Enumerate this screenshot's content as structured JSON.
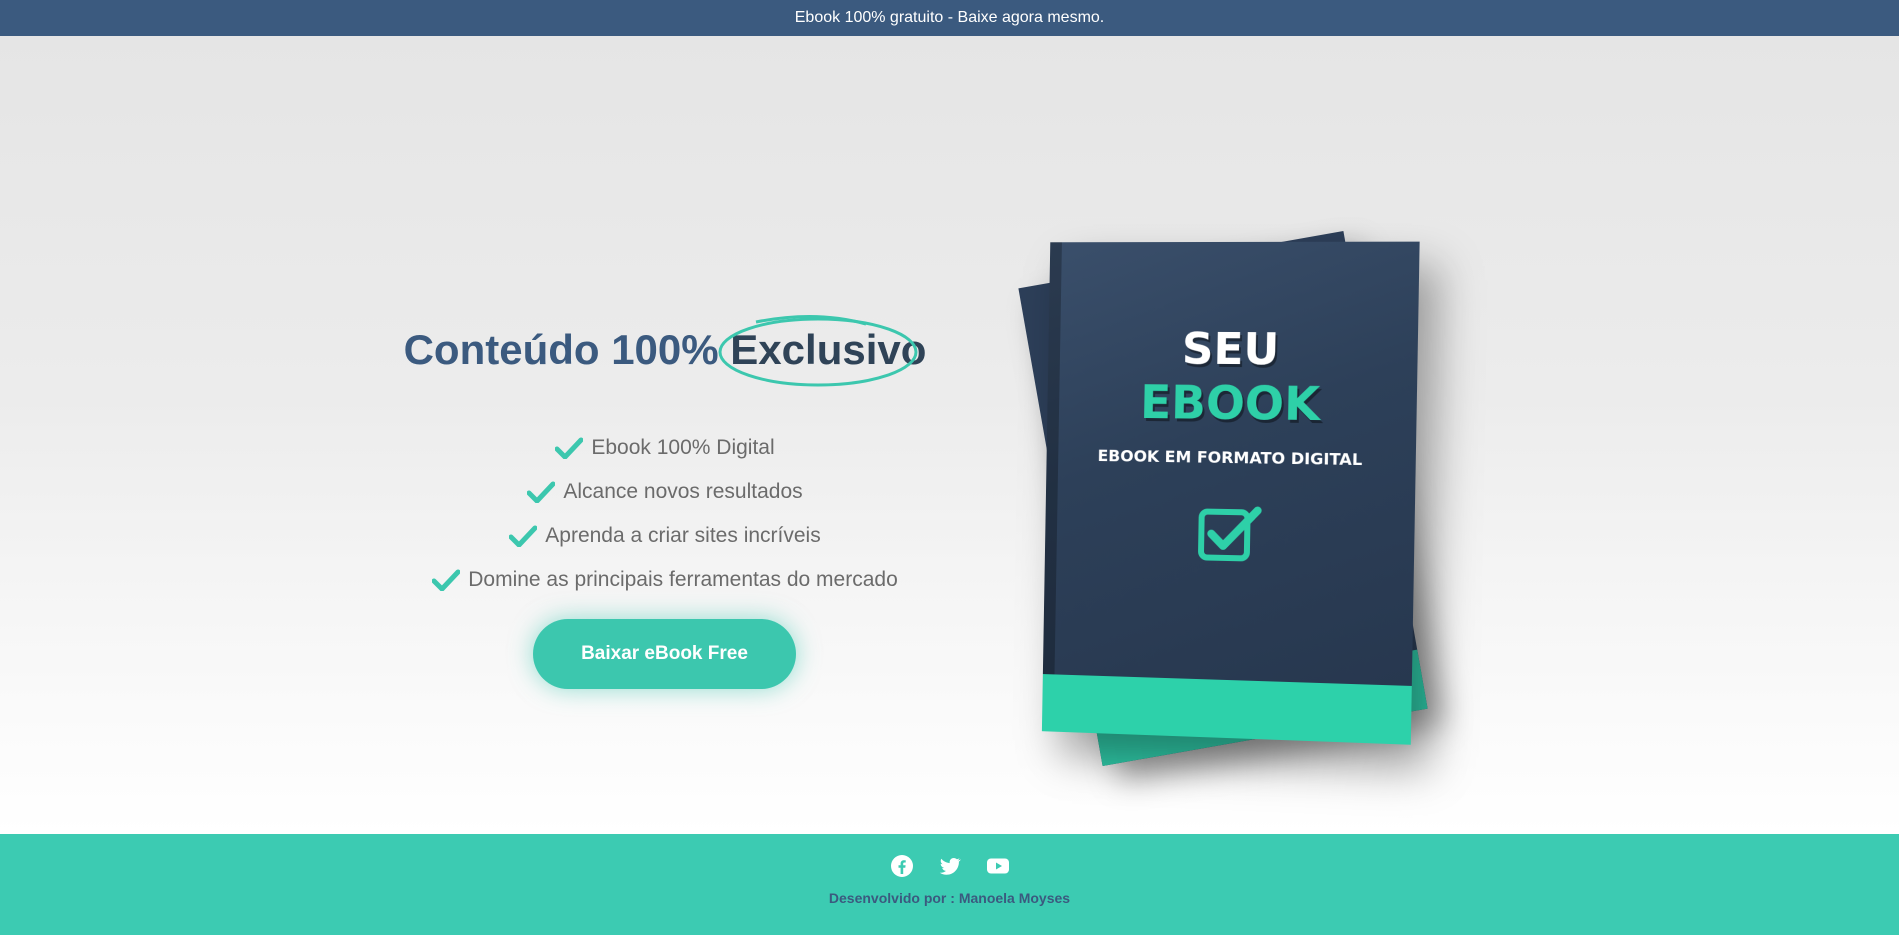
{
  "topbar": {
    "text": "Ebook 100% gratuito - Baixe agora mesmo."
  },
  "hero": {
    "headline_prefix": "Conteúdo 100% ",
    "headline_highlight": "Exclusivo",
    "features": [
      "Ebook 100% Digital",
      "Alcance novos resultados",
      "Aprenda a criar sites incríveis",
      "Domine as principais ferramentas do mercado"
    ],
    "cta_label": "Baixar eBook Free"
  },
  "book": {
    "title_line1": "SEU",
    "title_line2": "EBOOK",
    "subtitle": "EBOOK EM FORMATO DIGITAL"
  },
  "footer": {
    "social_icons": [
      "facebook-icon",
      "twitter-icon",
      "youtube-icon"
    ],
    "credit": "Desenvolvido por : Manoela Moyses"
  },
  "colors": {
    "topbar": "#3b5a7f",
    "accent": "#3cc7ae",
    "heading": "#3b5a7f",
    "footer": "#3ccbb2"
  }
}
